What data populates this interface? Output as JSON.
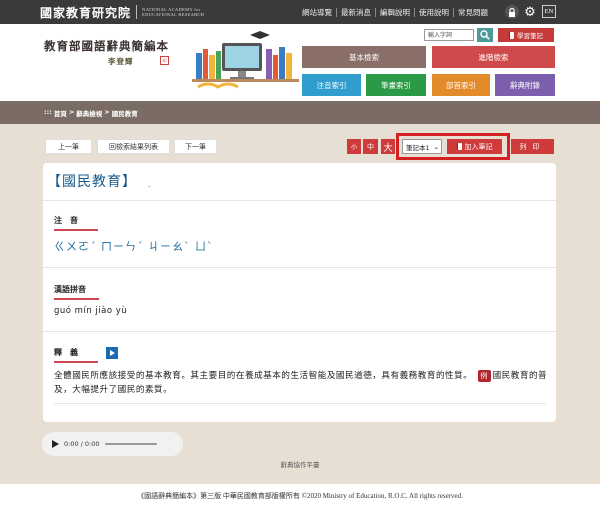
{
  "topbar": {
    "logo_cn": "國家教育研究院",
    "logo_en_line1": "NATIONAL ACADEMY for",
    "logo_en_line2": "EDUCATIONAL RESEARCH",
    "nav": [
      "網站導覽",
      "最新消息",
      "編輯說明",
      "使用說明",
      "常見問題"
    ],
    "lang_label": "EN"
  },
  "header": {
    "title": "教育部國語辭典簡編本",
    "author": "李登輝",
    "search_placeholder": "輸入字詞",
    "notes_label": "學習筆記",
    "buttons": {
      "basic": "基本檢索",
      "advanced": "進階檢索",
      "zhuyin_index": "注音索引",
      "stroke_index": "筆畫索引",
      "radical_index": "部首索引",
      "appendix": "辭典附錄"
    }
  },
  "breadcrumb": {
    "prefix": ":::",
    "items": [
      "首頁",
      "辭典檢視",
      "國民教育"
    ],
    "sep": ">"
  },
  "toolbar": {
    "prev": "上一筆",
    "back_to_results": "回檢索結果列表",
    "next": "下一筆",
    "font_small": "小",
    "font_medium": "中",
    "font_large": "大",
    "note_select": "筆記本1",
    "add_note": "加入筆記",
    "print": "列印"
  },
  "entry": {
    "title": "【國民教育】",
    "dot": ".",
    "zhuyin_label": "注　音",
    "zhuyin": "ㄍㄨㄛˊ ㄇㄧㄣˊ ㄐㄧㄠˋ ㄩˋ",
    "pinyin_label": "漢語拼音",
    "pinyin": "guó mín jiào yù",
    "definition_label": "釋　義",
    "definition": "全體國民所應該接受的基本教育。其主要目的在養成基本的生活智能及國民道德，具有義務教育的性質。",
    "example_badge": "例",
    "example": "國民教育的普及，大幅提升了國民的素質。"
  },
  "audio": {
    "time": "0:00 / 0:00"
  },
  "credit": "辭典協作平臺",
  "footer": "《國語辭典簡編本》第三版 中華民國教育部版權所有 ©2020 Ministry of Education, R.O.C. All rights reserved."
}
